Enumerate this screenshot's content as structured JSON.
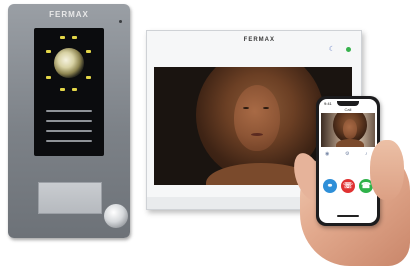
{
  "panel": {
    "brand": "FERMAX"
  },
  "monitor": {
    "brand": "FERMAX",
    "status_led_color": "#37b24d",
    "moon_icon": "moon-icon"
  },
  "phone": {
    "time": "9:41",
    "header": "Call",
    "toolbar_icons": [
      "camera-icon",
      "gear-icon",
      "mute-icon"
    ],
    "buttons": {
      "key_icon": "key-icon",
      "hangup_icon": "hangup-icon",
      "answer_icon": "answer-icon"
    },
    "colors": {
      "key": "#2e8fd8",
      "hangup": "#e03131",
      "answer": "#2fb24a"
    }
  }
}
